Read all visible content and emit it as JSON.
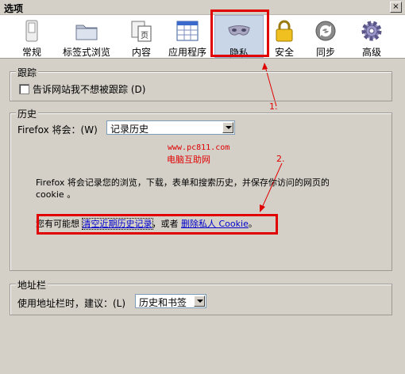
{
  "window": {
    "title": "选项",
    "close_glyph": "×"
  },
  "tabs": [
    {
      "id": "general",
      "label": "常规",
      "icon": "switch-icon"
    },
    {
      "id": "tabs",
      "label": "标签式浏览",
      "icon": "folder-icon"
    },
    {
      "id": "content",
      "label": "内容",
      "icon": "page-icon"
    },
    {
      "id": "apps",
      "label": "应用程序",
      "icon": "window-grid-icon"
    },
    {
      "id": "privacy",
      "label": "隐私",
      "icon": "mask-icon",
      "selected": true
    },
    {
      "id": "security",
      "label": "安全",
      "icon": "lock-icon"
    },
    {
      "id": "sync",
      "label": "同步",
      "icon": "sync-icon"
    },
    {
      "id": "advanced",
      "label": "高级",
      "icon": "gear-icon"
    }
  ],
  "tracking": {
    "title": "跟踪",
    "checkbox_label": "告诉网站我不想被跟踪 (D)",
    "checked": false
  },
  "history": {
    "title": "历史",
    "will_label": "Firefox 将会：(W)",
    "select_value": "记录历史",
    "description_line1": "Firefox 将会记录您的浏览，下载，表单和搜索历史，并保存你访问的网页的",
    "description_line2": "cookie 。",
    "maybe_prefix": "您有可能想",
    "clear_history_link": "清空近期历史记录",
    "or_text": "，或者",
    "remove_cookies_link": "删除私人 Cookie",
    "period": "。"
  },
  "urlbar": {
    "title": "地址栏",
    "label": "使用地址栏时，建议：(L)",
    "select_value": "历史和书签"
  },
  "annotations": {
    "marker1": "1.",
    "marker2": "2.",
    "watermark_url": "www.pc811.com",
    "watermark_name": "电脑互助网"
  },
  "colors": {
    "annotation_red": "#e00000",
    "link_blue": "#0000cc",
    "selected_tab": "#c9d6e8"
  }
}
